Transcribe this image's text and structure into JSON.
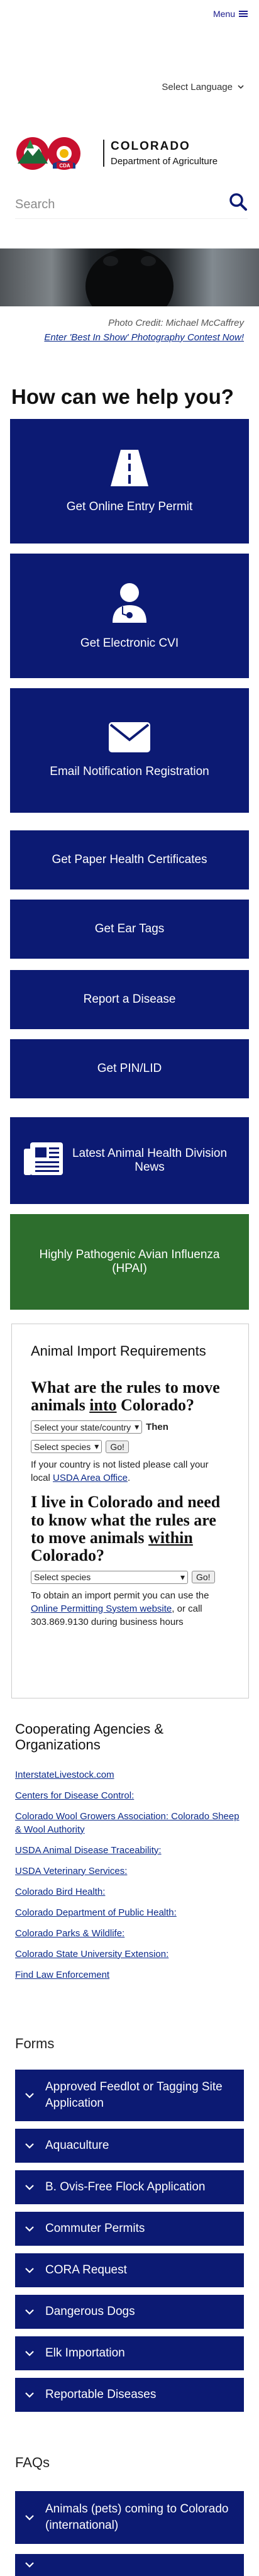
{
  "header": {
    "menu_label": "Menu",
    "language_label": "Select Language"
  },
  "logo": {
    "line1": "COLORADO",
    "line2": "Department of Agriculture",
    "badge": "CDA"
  },
  "search": {
    "placeholder": "Search"
  },
  "hero": {
    "credit": "Photo Credit: Michael McCaffrey",
    "contest_link": "Enter 'Best In Show' Photography Contest Now!"
  },
  "help": {
    "title": "How can we help you?",
    "tiles": [
      {
        "label": "Get Online Entry Permit",
        "icon": "road-icon"
      },
      {
        "label": "Get Electronic CVI",
        "icon": "veterinarian-icon"
      },
      {
        "label": "Email Notification Registration",
        "icon": "envelope-icon"
      },
      {
        "label": "Get Paper Health Certificates"
      },
      {
        "label": "Get Ear Tags"
      },
      {
        "label": "Report a Disease"
      },
      {
        "label": "Get PIN/LID"
      },
      {
        "label": "Latest Animal Health Division News",
        "icon": "newspaper-icon"
      },
      {
        "label": "Highly Pathogenic Avian Influenza (HPAI)"
      }
    ]
  },
  "import": {
    "title": "Animal Import Requirements",
    "q1_a": "What are the rules to move animals ",
    "q1_b": "into",
    "q1_c": " Colorado?",
    "state_select": "Select your state/country",
    "then_label": "Then",
    "species_select": "Select species",
    "go_label": "Go!",
    "note1_a": "If your country is not listed please call your local ",
    "note1_link": "USDA Area Office",
    "note1_b": ".",
    "q2_a": "I live in Colorado and need to know what the rules are to move animals ",
    "q2_b": "within",
    "q2_c": " Colorado?",
    "species_select2": "Select species",
    "go_label2": "Go!",
    "note2_a": "To obtain an import permit you can use the ",
    "note2_link": "Online Permitting System website",
    "note2_b": ", or call 303.869.9130 during business hours"
  },
  "coop": {
    "title": "Cooperating Agencies & Organizations",
    "links": [
      "InterstateLivestock.com",
      "Centers for Disease Control:",
      "Colorado Wool Growers Association: Colorado Sheep & Wool Authority",
      "USDA Animal Disease Traceability:",
      "USDA Veterinary Services:",
      "Colorado Bird Health:",
      "Colorado Department of Public Health:",
      "Colorado Parks & Wildlife:",
      "Colorado State University Extension:",
      "Find Law Enforcement"
    ]
  },
  "forms": {
    "title": "Forms",
    "items": [
      "Approved Feedlot or Tagging Site Application",
      "Aquaculture",
      "B. Ovis-Free Flock Application",
      "Commuter Permits",
      "CORA Request",
      "Dangerous Dogs",
      "Elk Importation",
      "Reportable Diseases"
    ]
  },
  "faqs": {
    "title": "FAQs",
    "items": [
      "Animals (pets) coming to Colorado (international)"
    ]
  },
  "colors": {
    "navy": "#0c1a73",
    "green": "#2d6e2d",
    "link": "#0b2a8a"
  }
}
